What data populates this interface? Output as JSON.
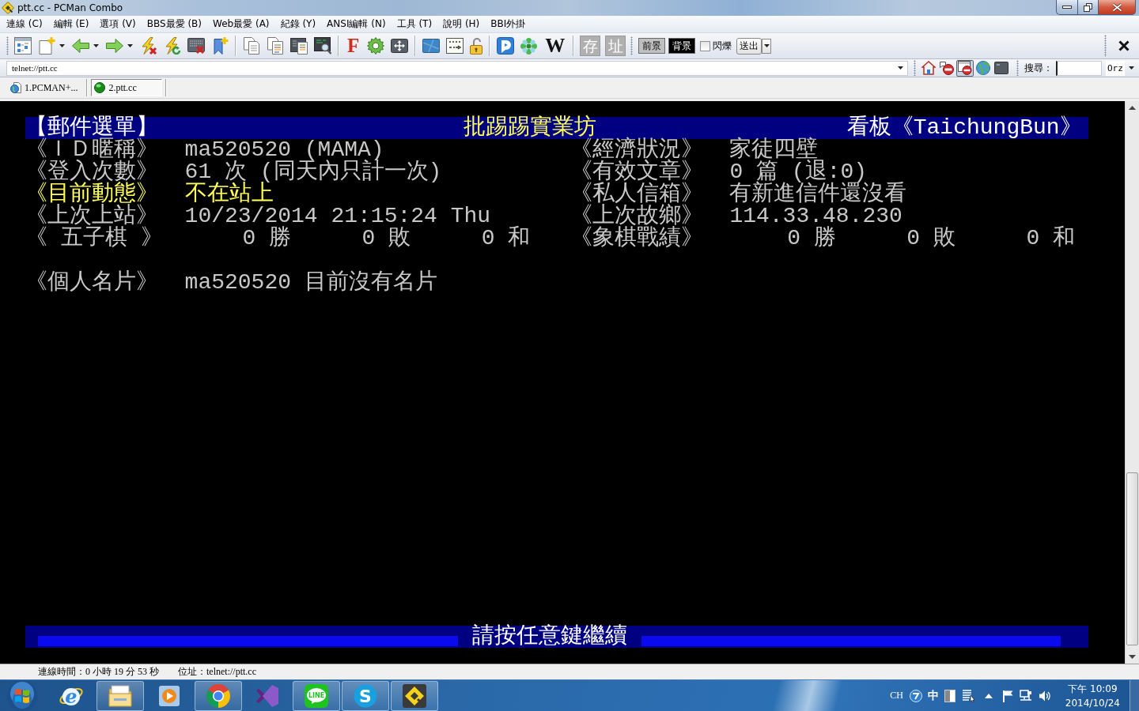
{
  "window": {
    "title": "ptt.cc - PCMan Combo"
  },
  "menu": [
    "連線 (C)",
    "編輯 (E)",
    "選項 (V)",
    "BBS最愛 (B)",
    "Web最愛 (A)",
    "紀錄 (Y)",
    "ANSI編輯 (N)",
    "工具 (T)",
    "說明 (H)",
    "BBI外掛"
  ],
  "toolbar": {
    "letter_buttons": [
      "F",
      "W"
    ],
    "tile_buttons": [
      "存",
      "址"
    ],
    "color_buttons": [
      {
        "label": "前景",
        "color": "#c0c0c0"
      },
      {
        "label": "背景",
        "color": "#000000"
      }
    ],
    "blink": {
      "label": "閃爍",
      "checked": false
    },
    "send_button": "送出"
  },
  "address_bar": {
    "value": "telnet://ptt.cc"
  },
  "quick_tools": [
    {
      "on": false
    },
    {
      "on": false
    },
    {
      "on": true
    },
    {
      "on": false
    },
    {
      "on": false
    }
  ],
  "search": {
    "label": "搜尋：",
    "engine": "Orz"
  },
  "tabs": [
    {
      "label": "1.PCMAN+...",
      "selected": false
    },
    {
      "label": "2.ptt.cc",
      "selected": true
    }
  ],
  "terminal": {
    "header": {
      "menu_title": "【郵件選單】",
      "site_name": "批踢踢實業坊",
      "board": "看板《TaichungBun》"
    },
    "rows": [
      {
        "kind": "info",
        "fields": [
          {
            "label": "《ＩＤ暱稱》",
            "value": "ma520520 (MAMA)",
            "highlighted": false
          },
          {
            "label": "《經濟狀況》",
            "value": "家徒四壁",
            "highlighted": false
          }
        ]
      },
      {
        "kind": "info",
        "fields": [
          {
            "label": "《登入次數》",
            "value": "61 次 (同天內只計一次)",
            "highlighted": false
          },
          {
            "label": "《有效文章》",
            "value": "0 篇 (退:0)",
            "highlighted": false
          }
        ]
      },
      {
        "kind": "info",
        "fields": [
          {
            "label": "《目前動態》",
            "value": "不在站上",
            "highlighted": true
          },
          {
            "label": "《私人信箱》",
            "value": "有新進信件還沒看",
            "highlighted": false
          }
        ]
      },
      {
        "kind": "info",
        "fields": [
          {
            "label": "《上次上站》",
            "value": "10/23/2014 21:15:24 Thu",
            "highlighted": false
          },
          {
            "label": "《上次故鄉》",
            "value": "114.33.48.230",
            "highlighted": false
          }
        ]
      },
      {
        "kind": "record",
        "fields": [
          {
            "label": "《 五子棋 》",
            "results": [
              "0 勝",
              "0 敗",
              "0 和"
            ],
            "highlighted": false
          },
          {
            "label": "《象棋戰績》",
            "results": [
              "0 勝",
              "0 敗",
              "0 和"
            ],
            "highlighted": false
          }
        ]
      },
      {
        "kind": "blank"
      },
      {
        "kind": "info",
        "fields": [
          {
            "label": "《個人名片》",
            "value": "ma520520 目前沒有名片",
            "highlighted": false
          }
        ]
      }
    ],
    "prompt": "請按任意鍵繼續"
  },
  "status_bar": {
    "connection_time": "連線時間：0 小時 19 分 53 秒",
    "address": "位址：telnet://ptt.cc"
  },
  "taskbar": {
    "apps": [
      {
        "running": false,
        "logo_text": "e"
      },
      {
        "running": true
      },
      {
        "running": false
      },
      {
        "running": true
      },
      {
        "running": false
      },
      {
        "running": true,
        "logo_text": "LINE"
      },
      {
        "running": true,
        "logo_text": "S"
      },
      {
        "running": true
      }
    ],
    "tray": {
      "language": "CH",
      "ime_mode": "中",
      "time": "下午 10:09",
      "date": "2014/10/24"
    }
  }
}
